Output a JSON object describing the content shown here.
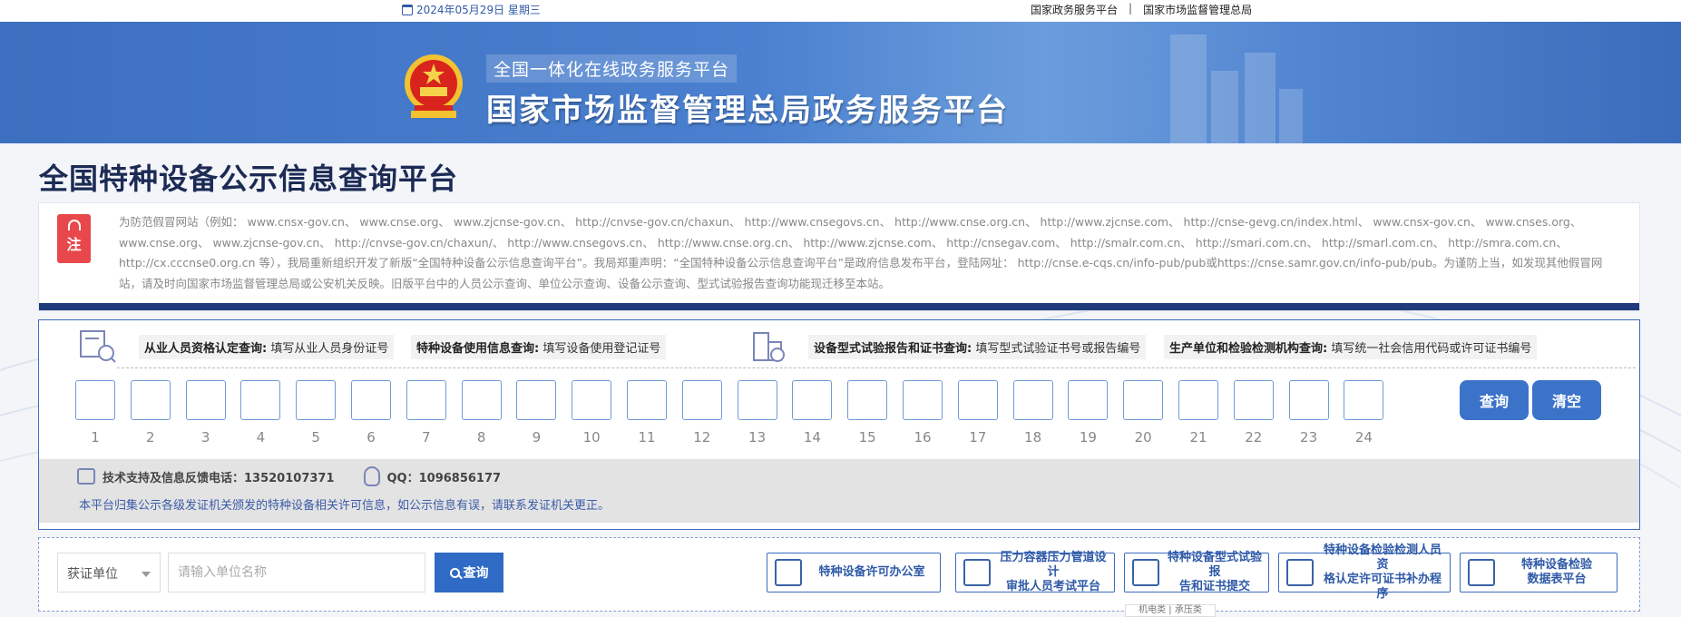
{
  "topbar": {
    "date": "2024年05月29日 星期三",
    "link1": "国家政务服务平台",
    "separator": "|",
    "link2": "国家市场监督管理总局"
  },
  "banner": {
    "subtitle": "全国一体化在线政务服务平台",
    "title": "国家市场监督管理总局政务服务平台"
  },
  "page": {
    "title": "全国特种设备公示信息查询平台"
  },
  "notice": {
    "tag": "注",
    "text": "为防范假冒网站（例如：  www.cnsx-gov.cn、  www.cnse.org、  www.zjcnse-gov.cn、  http://cnvse-gov.cn/chaxun、  http://www.cnsegovs.cn、  http://www.cnse.org.cn、  http://www.zjcnse.com、  http://cnse-gevg.cn/index.html、  www.cnsx-gov.cn、  www.cnses.org、  www.cnse.org、  www.zjcnse-gov.cn、  http://cnvse-gov.cn/chaxun/、  http://www.cnsegovs.cn、  http://www.cnse.org.cn、  http://www.zjcnse.com、  http://cnsegav.com、  http://smalr.com.cn、  http://smari.com.cn、  http://smarl.com.cn、  http://smra.com.cn、  http://cx.cccnse0.org.cn  等），我局重新组织开发了新版“全国特种设备公示信息查询平台”。我局郑重声明：“全国特种设备公示信息查询平台”是政府信息发布平台，登陆网址：  http://cnse.e-cqs.cn/info-pub/pub或https://cnse.samr.gov.cn/info-pub/pub。为谨防上当，如发现其他假冒网站，请及时向国家市场监督管理总局或公安机关反映。旧版平台中的人员公示查询、单位公示查询、设备公示查询、型式试验报告查询功能现迁移至本站。"
  },
  "query": {
    "options": [
      {
        "label": "从业人员资格认定查询:",
        "hint": "填写从业人员身份证号"
      },
      {
        "label": "特种设备使用信息查询:",
        "hint": "填写设备使用登记证号"
      },
      {
        "label": "设备型式试验报告和证书查询:",
        "hint": "填写型式试验证书号或报告编号"
      },
      {
        "label": "生产单位和检验检测机构查询:",
        "hint": "填写统一社会信用代码或许可证书编号"
      }
    ],
    "digits": [
      "1",
      "2",
      "3",
      "4",
      "5",
      "6",
      "7",
      "8",
      "9",
      "10",
      "11",
      "12",
      "13",
      "14",
      "15",
      "16",
      "17",
      "18",
      "19",
      "20",
      "21",
      "22",
      "23",
      "24"
    ],
    "query_button": "查询",
    "clear_button": "清空"
  },
  "support": {
    "phone_label": "技术支持及信息反馈电话：13520107371",
    "qq_label": "QQ：1096856177",
    "disclaimer": "本平台归集公示各级发证机关颁发的特种设备相关许可信息，如公示信息有误，请联系发证机关更正。"
  },
  "unit_search": {
    "select_value": "获证单位",
    "placeholder": "请输入单位名称",
    "button": "查询"
  },
  "services": [
    {
      "icon": "license-office-icon",
      "label": "特种设备许可办公室"
    },
    {
      "icon": "pressure-vessel-icon",
      "label": "压力容器压力管道设计\n审批人员考试平台"
    },
    {
      "icon": "cube-icon",
      "label": "特种设备型式试验报\n告和证书提交"
    },
    {
      "icon": "inspector-icon",
      "label": "特种设备检验检测人员资\n格认定许可证书补办程序"
    },
    {
      "icon": "data-table-icon",
      "label": "特种设备检验\n数据表平台"
    }
  ],
  "tooltip": "机电类 | 承压类"
}
